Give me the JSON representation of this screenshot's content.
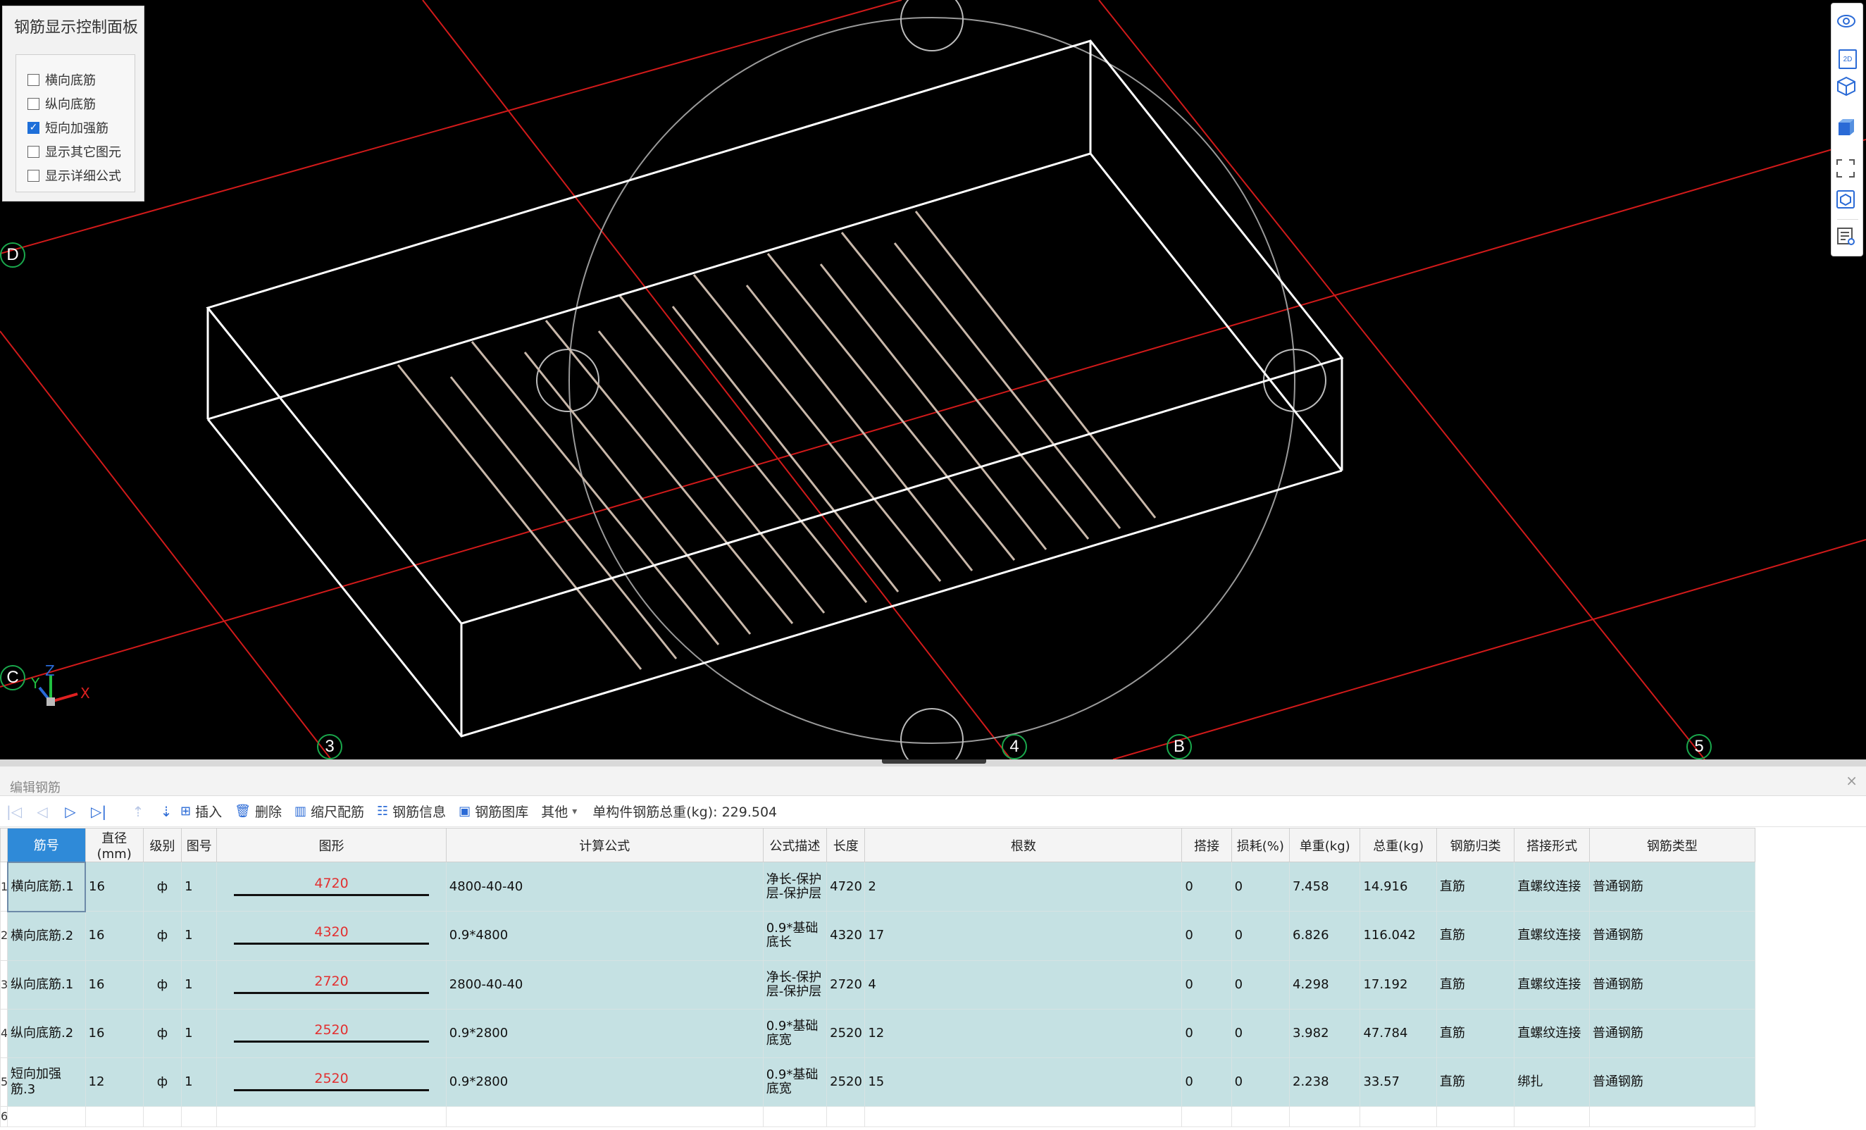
{
  "control_panel": {
    "title": "钢筋显示控制面板",
    "options": [
      {
        "label": "横向底筋",
        "checked": false
      },
      {
        "label": "纵向底筋",
        "checked": false
      },
      {
        "label": "短向加强筋",
        "checked": true
      },
      {
        "label": "显示其它图元",
        "checked": false
      },
      {
        "label": "显示详细公式",
        "checked": false
      }
    ]
  },
  "viewport": {
    "axis_labels": [
      "D",
      "C",
      "3",
      "4",
      "B",
      "5"
    ],
    "coord_axes": {
      "x": "X",
      "y": "Y",
      "z": "Z"
    },
    "toolstrip": [
      "orbit-icon",
      "view-2d-icon",
      "view-3d-icon",
      "solid-box-icon",
      "fullscreen-icon",
      "view-cube-icon",
      "properties-icon"
    ],
    "view_2d_label": "2D"
  },
  "editor": {
    "title": "编辑钢筋",
    "close": "×",
    "toolbar": {
      "insert": "插入",
      "delete": "删除",
      "scale_rebar": "缩尺配筋",
      "rebar_info": "钢筋信息",
      "rebar_library": "钢筋图库",
      "other": "其他",
      "other_arrow": "▾",
      "total_label": "单构件钢筋总重(kg): 229.504"
    },
    "columns": [
      "筋号",
      "直径(mm)",
      "级别",
      "图号",
      "图形",
      "计算公式",
      "公式描述",
      "长度",
      "根数",
      "搭接",
      "损耗(%)",
      "单重(kg)",
      "总重(kg)",
      "钢筋归类",
      "搭接形式",
      "钢筋类型"
    ],
    "rows": [
      {
        "no": "1",
        "name": "横向底筋.1",
        "dia": "16",
        "grade": "ф",
        "fig": "1",
        "shape": "4720",
        "formula": "4800-40-40",
        "desc": "净长-保护层-保护层",
        "length": "4720",
        "count": "2",
        "lap": "0",
        "loss": "0",
        "unit_w": "7.458",
        "total_w": "14.916",
        "category": "直筋",
        "lap_type": "直螺纹连接",
        "rebar_type": "普通钢筋"
      },
      {
        "no": "2",
        "name": "横向底筋.2",
        "dia": "16",
        "grade": "ф",
        "fig": "1",
        "shape": "4320",
        "formula": "0.9*4800",
        "desc": "0.9*基础底长",
        "length": "4320",
        "count": "17",
        "lap": "0",
        "loss": "0",
        "unit_w": "6.826",
        "total_w": "116.042",
        "category": "直筋",
        "lap_type": "直螺纹连接",
        "rebar_type": "普通钢筋"
      },
      {
        "no": "3",
        "name": "纵向底筋.1",
        "dia": "16",
        "grade": "ф",
        "fig": "1",
        "shape": "2720",
        "formula": "2800-40-40",
        "desc": "净长-保护层-保护层",
        "length": "2720",
        "count": "4",
        "lap": "0",
        "loss": "0",
        "unit_w": "4.298",
        "total_w": "17.192",
        "category": "直筋",
        "lap_type": "直螺纹连接",
        "rebar_type": "普通钢筋"
      },
      {
        "no": "4",
        "name": "纵向底筋.2",
        "dia": "16",
        "grade": "ф",
        "fig": "1",
        "shape": "2520",
        "formula": "0.9*2800",
        "desc": "0.9*基础底宽",
        "length": "2520",
        "count": "12",
        "lap": "0",
        "loss": "0",
        "unit_w": "3.982",
        "total_w": "47.784",
        "category": "直筋",
        "lap_type": "直螺纹连接",
        "rebar_type": "普通钢筋"
      },
      {
        "no": "5",
        "name": "短向加强筋.3",
        "dia": "12",
        "grade": "ф",
        "fig": "1",
        "shape": "2520",
        "formula": "0.9*2800",
        "desc": "0.9*基础底宽",
        "length": "2520",
        "count": "15",
        "lap": "0",
        "loss": "0",
        "unit_w": "2.238",
        "total_w": "33.57",
        "category": "直筋",
        "lap_type": "绑扎",
        "rebar_type": "普通钢筋"
      }
    ],
    "empty_row_no": "6"
  },
  "colors": {
    "grid_red": "#d11a1a",
    "wire": "#ffffff",
    "rebar": "#c9b8aa",
    "row_bg": "#c5e1e3",
    "header_sel": "#2f8ad8"
  }
}
